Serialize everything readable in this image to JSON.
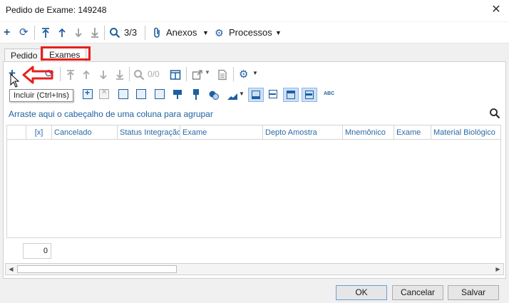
{
  "window": {
    "title": "Pedido de Exame: 149248",
    "close": "✕"
  },
  "toolbar": {
    "counter": "3/3",
    "anexos_label": "Anexos",
    "processos_label": "Processos"
  },
  "tabs": [
    {
      "label": "Pedido",
      "active": false
    },
    {
      "label": "Exames",
      "active": true
    }
  ],
  "inner_toolbar": {
    "counter": "0/0"
  },
  "tooltip": "Incluir (Ctrl+Ins)",
  "grid": {
    "group_hint": "Arraste aqui o cabeçalho de uma coluna para agrupar",
    "columns": [
      "[x]",
      "Cancelado",
      "Status Integração",
      "Exame",
      "Depto Amostra",
      "Mnemônico",
      "Exame",
      "Material Biológico"
    ],
    "row_count": "0"
  },
  "buttons": {
    "ok": "OK",
    "cancel": "Cancelar",
    "save": "Salvar"
  },
  "colors": {
    "accent": "#1f5f9e",
    "highlight": "#e8201d"
  },
  "icons": [
    "add-icon",
    "refresh-icon",
    "first-icon",
    "up-icon",
    "down-icon",
    "last-icon",
    "search-icon",
    "paperclip-icon",
    "gear-icon"
  ]
}
